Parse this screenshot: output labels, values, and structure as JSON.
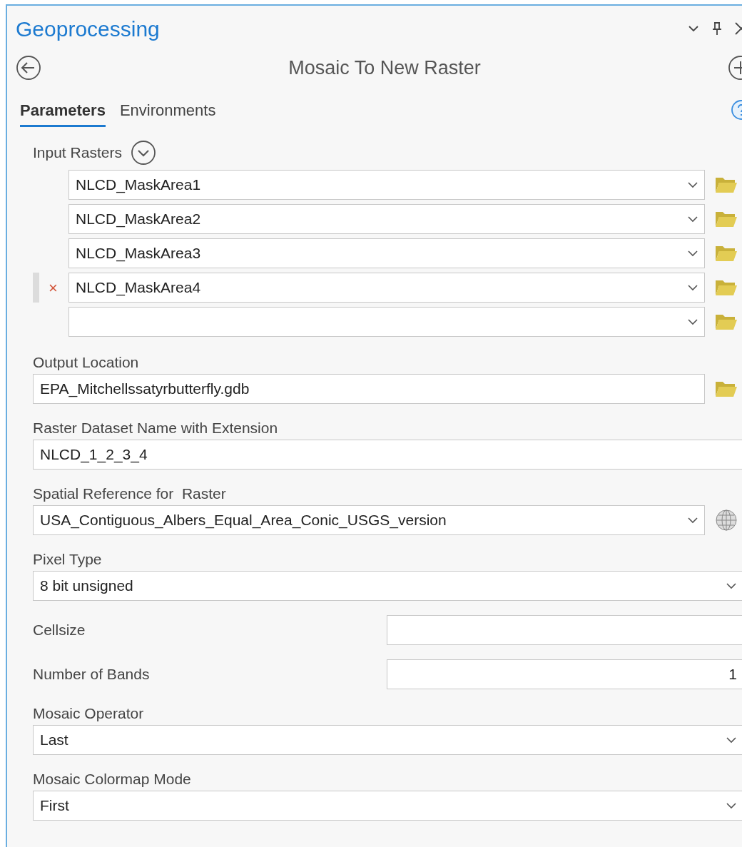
{
  "pane": {
    "title": "Geoprocessing"
  },
  "tool": {
    "title": "Mosaic To New Raster"
  },
  "tabs": [
    {
      "label": "Parameters",
      "selected": true
    },
    {
      "label": "Environments",
      "selected": false
    }
  ],
  "parameters": [
    {
      "kind": "multi",
      "label": "Input Rasters",
      "rows": [
        {
          "value": "NLCD_MaskArea1",
          "selected": false
        },
        {
          "value": "NLCD_MaskArea2",
          "selected": false
        },
        {
          "value": "NLCD_MaskArea3",
          "selected": false
        },
        {
          "value": "NLCD_MaskArea4",
          "selected": true,
          "remove_mark": "×"
        },
        {
          "selected": false
        }
      ]
    },
    {
      "kind": "path",
      "label": "Output Location",
      "value": "EPA_Mitchellssatyrbutterfly.gdb"
    },
    {
      "kind": "text",
      "label": "Raster Dataset Name with Extension",
      "value": "NLCD_1_2_3_4"
    },
    {
      "kind": "spatial_ref",
      "label": "Spatial Reference for  Raster",
      "value": "USA_Contiguous_Albers_Equal_Area_Conic_USGS_version"
    },
    {
      "kind": "dropdown",
      "label": "Pixel Type",
      "value": "8 bit unsigned"
    },
    {
      "kind": "inline",
      "label": "Cellsize"
    },
    {
      "kind": "number",
      "label": "Number of Bands",
      "value": "1"
    },
    {
      "kind": "dropdown",
      "label": "Mosaic Operator",
      "value": "Last"
    },
    {
      "kind": "dropdown",
      "label": "Mosaic Colormap Mode",
      "value": "First"
    }
  ]
}
